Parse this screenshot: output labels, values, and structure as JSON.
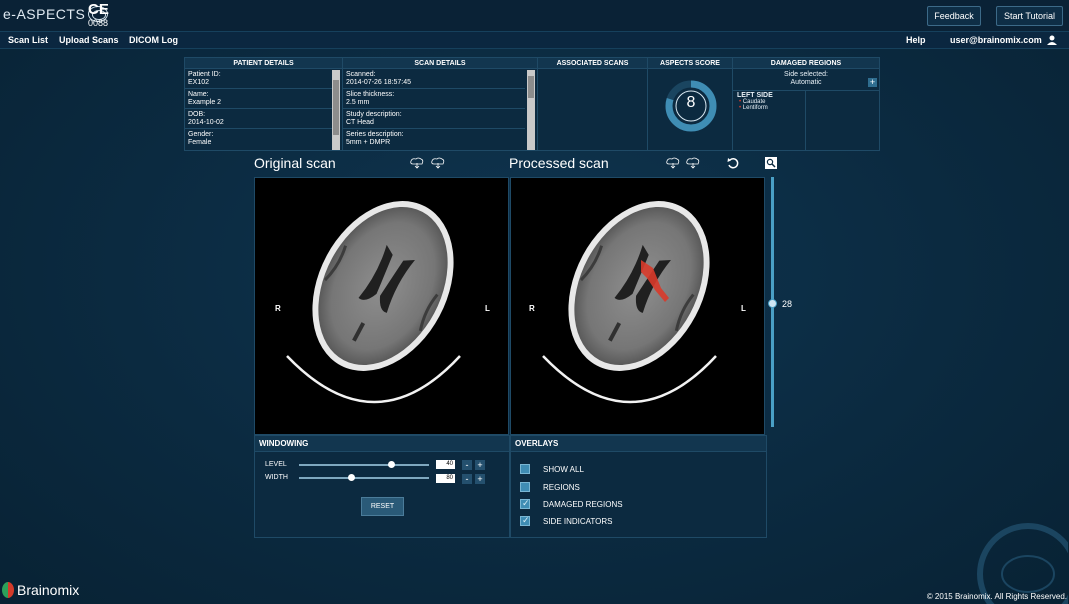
{
  "app": {
    "logo_text": "e-ASPECTS",
    "ce_mark": "CE",
    "ce_number": "0088"
  },
  "header": {
    "feedback_label": "Feedback",
    "tutorial_label": "Start Tutorial"
  },
  "nav": {
    "items": [
      "Scan List",
      "Upload Scans",
      "DICOM Log"
    ],
    "help": "Help",
    "user": "user@brainomix.com"
  },
  "patient": {
    "header": "PATIENT DETAILS",
    "fields": [
      {
        "label": "Patient ID:",
        "value": "EX102"
      },
      {
        "label": "Name:",
        "value": "Example 2"
      },
      {
        "label": "DOB:",
        "value": "2014-10-02"
      },
      {
        "label": "Gender:",
        "value": "Female"
      }
    ]
  },
  "scan": {
    "header": "SCAN DETAILS",
    "fields": [
      {
        "label": "Scanned:",
        "value": "2014-07-26 18:57:45"
      },
      {
        "label": "Slice thickness:",
        "value": "2.5 mm"
      },
      {
        "label": "Study description:",
        "value": "CT Head"
      },
      {
        "label": "Series description:",
        "value": "5mm + DMPR"
      }
    ]
  },
  "associated": {
    "header": "ASSOCIATED SCANS"
  },
  "aspects": {
    "header": "ASPECTS SCORE",
    "score": "8",
    "fraction": 0.8
  },
  "damaged": {
    "header": "DAMAGED REGIONS",
    "side_selected_label": "Side selected:",
    "side_selected_value": "Automatic",
    "side_label": "LEFT SIDE",
    "regions": [
      "Caudate",
      "Lentiform"
    ]
  },
  "viewer": {
    "original_title": "Original scan",
    "processed_title": "Processed scan",
    "left_marker": "R",
    "right_marker": "L",
    "slice_number": "28"
  },
  "windowing": {
    "header": "WINDOWING",
    "level_label": "LEVEL",
    "level_value": "40",
    "width_label": "WIDTH",
    "width_value": "80",
    "reset_label": "RESET"
  },
  "overlays": {
    "header": "OVERLAYS",
    "items": [
      {
        "label": "SHOW ALL",
        "checked": false
      },
      {
        "label": "REGIONS",
        "checked": false
      },
      {
        "label": "DAMAGED REGIONS",
        "checked": true
      },
      {
        "label": "SIDE INDICATORS",
        "checked": true
      }
    ]
  },
  "footer": {
    "brand": "Brainomix",
    "copyright": "© 2015 Brainomix. All Rights Reserved."
  },
  "colors": {
    "accent": "#3f8db4",
    "lesion": "#d93a2a",
    "background": "#0b2a40"
  }
}
